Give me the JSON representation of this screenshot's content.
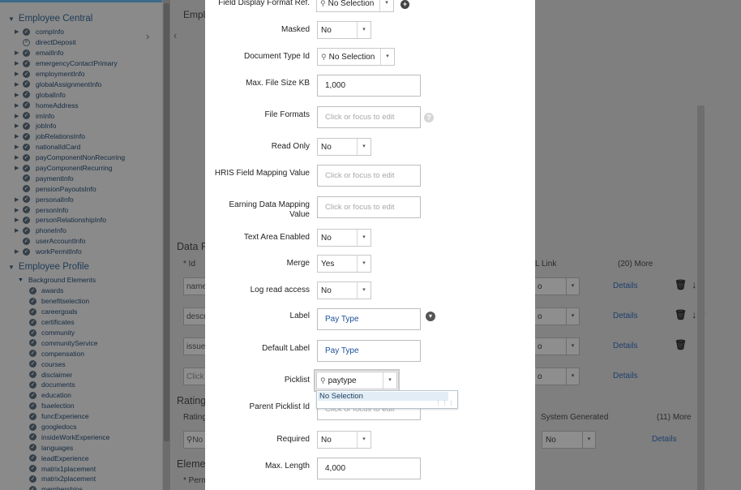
{
  "sidebar": {
    "employee_central": {
      "title": "Employee Central",
      "items": [
        {
          "label": "compInfo",
          "expandable": true,
          "status": "check"
        },
        {
          "label": "directDeposit",
          "expandable": false,
          "status": "x"
        },
        {
          "label": "emailInfo",
          "expandable": true,
          "status": "check"
        },
        {
          "label": "emergencyContactPrimary",
          "expandable": true,
          "status": "check"
        },
        {
          "label": "employmentInfo",
          "expandable": true,
          "status": "check"
        },
        {
          "label": "globalAssignmentInfo",
          "expandable": true,
          "status": "check"
        },
        {
          "label": "globalInfo",
          "expandable": true,
          "status": "check"
        },
        {
          "label": "homeAddress",
          "expandable": true,
          "status": "check"
        },
        {
          "label": "imInfo",
          "expandable": true,
          "status": "check"
        },
        {
          "label": "jobInfo",
          "expandable": true,
          "status": "check"
        },
        {
          "label": "jobRelationsInfo",
          "expandable": true,
          "status": "check"
        },
        {
          "label": "nationalIdCard",
          "expandable": true,
          "status": "check"
        },
        {
          "label": "payComponentNonRecurring",
          "expandable": true,
          "status": "check"
        },
        {
          "label": "payComponentRecurring",
          "expandable": true,
          "status": "check"
        },
        {
          "label": "paymentInfo",
          "expandable": false,
          "status": "check"
        },
        {
          "label": "pensionPayoutsInfo",
          "expandable": false,
          "status": "check"
        },
        {
          "label": "personalInfo",
          "expandable": true,
          "status": "check"
        },
        {
          "label": "personInfo",
          "expandable": true,
          "status": "check"
        },
        {
          "label": "personRelationshipInfo",
          "expandable": true,
          "status": "check"
        },
        {
          "label": "phoneInfo",
          "expandable": true,
          "status": "check"
        },
        {
          "label": "userAccountInfo",
          "expandable": false,
          "status": "check"
        },
        {
          "label": "workPermitInfo",
          "expandable": true,
          "status": "check"
        }
      ]
    },
    "employee_profile": {
      "title": "Employee Profile",
      "background_elements_label": "Background Elements",
      "items": [
        "awards",
        "benefitselection",
        "careergoals",
        "certificates",
        "community",
        "communityService",
        "compensation",
        "courses",
        "disclaimer",
        "documents",
        "education",
        "fsaelection",
        "funcExperience",
        "googledocs",
        "insideWorkExperience",
        "languages",
        "leadExperience",
        "matrix1placement",
        "matrix2placement",
        "memberships"
      ]
    }
  },
  "background": {
    "header_title": "Emplo",
    "data_fields_title": "Data F",
    "id_column": "* Id",
    "link_column": "L Link",
    "more_20": "(20) More",
    "rows": [
      {
        "id": "name",
        "select": "o",
        "details": "Details"
      },
      {
        "id": "descr",
        "select": "o",
        "details": "Details"
      },
      {
        "id": "issue",
        "select": "o",
        "details": "Details"
      },
      {
        "id": "Click",
        "select": "o",
        "details": "Details"
      }
    ],
    "rating_title": "Rating",
    "rating_sub": "Rating",
    "system_generated": "System Generated",
    "more_11": "(11) More",
    "rating_combo": "No",
    "rating_select": "No",
    "rating_details": "Details",
    "elements_title": "Eleme",
    "perm_label": "* Perm"
  },
  "dialog": {
    "field_display_format": {
      "label": "Field Display Format Ref.",
      "value": "No Selection"
    },
    "masked": {
      "label": "Masked",
      "value": "No"
    },
    "document_type": {
      "label": "Document Type Id",
      "value": "No Selection"
    },
    "max_file_size": {
      "label": "Max. File Size KB",
      "value": "1,000"
    },
    "file_formats": {
      "label": "File Formats",
      "placeholder": "Click or focus to edit"
    },
    "read_only": {
      "label": "Read Only",
      "value": "No"
    },
    "hris_mapping": {
      "label": "HRIS Field Mapping Value",
      "placeholder": "Click or focus to edit"
    },
    "earning_mapping": {
      "label_line1": "Earning Data Mapping",
      "label_line2": "Value",
      "placeholder": "Click or focus to edit"
    },
    "text_area": {
      "label": "Text Area Enabled",
      "value": "No"
    },
    "merge": {
      "label": "Merge",
      "value": "Yes"
    },
    "log_read": {
      "label": "Log read access",
      "value": "No"
    },
    "label_field": {
      "label": "Label",
      "value": "Pay Type"
    },
    "default_label": {
      "label": "Default Label",
      "value": "Pay Type"
    },
    "picklist": {
      "label": "Picklist",
      "value": "paytype",
      "dropdown_option": "No Selection"
    },
    "parent_picklist": {
      "label": "Parent Picklist Id",
      "placeholder": "Click or focus to edit"
    },
    "required": {
      "label": "Required",
      "value": "No"
    },
    "max_length": {
      "label": "Max. Length",
      "value": "4,000"
    }
  }
}
